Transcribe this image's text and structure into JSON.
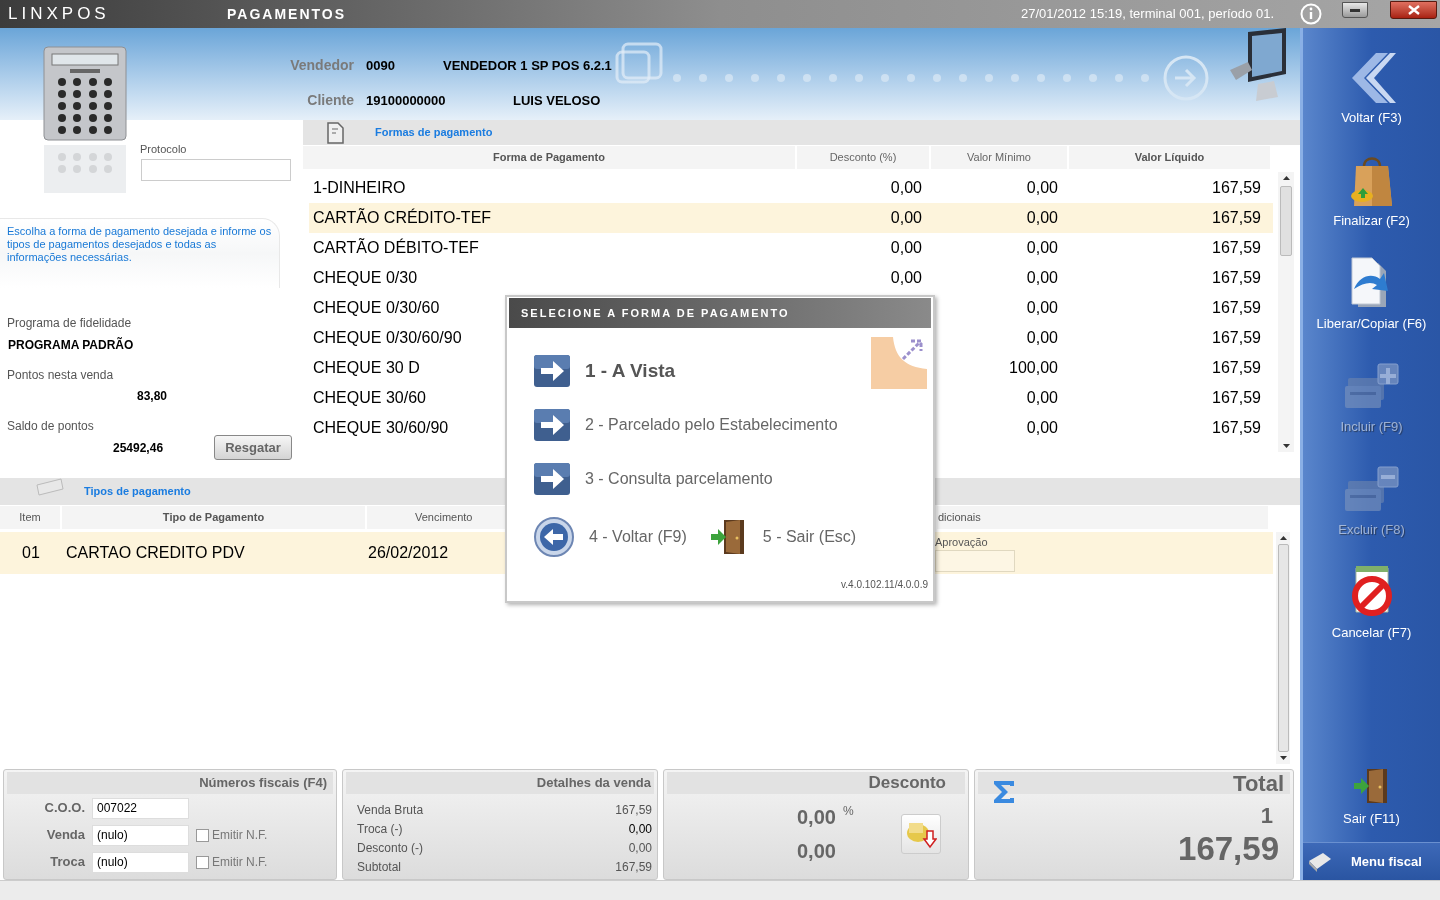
{
  "title_bar": {
    "app_name": "LINXPOS",
    "screen_title": "PAGAMENTOS",
    "session_info": "27/01/2012 15:19, terminal 001, período 01."
  },
  "header": {
    "vendedor": {
      "label": "Vendedor",
      "code": "0090",
      "name": "VENDEDOR 1 SP POS 6.2.1"
    },
    "cliente": {
      "label": "Cliente",
      "code": "19100000000",
      "name": "LUIS VELOSO"
    }
  },
  "protocolo": {
    "label": "Protocolo"
  },
  "help_text": "Escolha a forma de pagamento desejada e informe os tipos de pagamentos desejados e todas as informações necessárias.",
  "loyalty": {
    "program_label": "Programa de fidelidade",
    "program_name": "PROGRAMA PADRÃO",
    "points_label": "Pontos nesta venda",
    "points": "83,80",
    "balance_label": "Saldo de pontos",
    "balance": "25492,46",
    "redeem_button": "Resgatar"
  },
  "payment_forms": {
    "title": "Formas de pagamento",
    "columns": [
      "Forma de Pagamento",
      "Desconto (%)",
      "Valor Mínimo",
      "Valor Líquido"
    ],
    "rows": [
      {
        "name": "1-DINHEIRO",
        "discount": "0,00",
        "minimum": "0,00",
        "net": "167,59",
        "selected": false
      },
      {
        "name": "CARTÃO CRÉDITO-TEF",
        "discount": "0,00",
        "minimum": "0,00",
        "net": "167,59",
        "selected": true
      },
      {
        "name": "CARTÃO DÉBITO-TEF",
        "discount": "0,00",
        "minimum": "0,00",
        "net": "167,59",
        "selected": false
      },
      {
        "name": "CHEQUE 0/30",
        "discount": "0,00",
        "minimum": "0,00",
        "net": "167,59",
        "selected": false
      },
      {
        "name": "CHEQUE 0/30/60",
        "minimum": "0,00",
        "net": "167,59",
        "selected": false
      },
      {
        "name": "CHEQUE 0/30/60/90",
        "minimum": "0,00",
        "net": "167,59",
        "selected": false
      },
      {
        "name": "CHEQUE 30 D",
        "minimum": "100,00",
        "net": "167,59",
        "selected": false
      },
      {
        "name": "CHEQUE 30/60",
        "minimum": "0,00",
        "net": "167,59",
        "selected": false
      },
      {
        "name": "CHEQUE 30/60/90",
        "minimum": "0,00",
        "net": "167,59",
        "selected": false
      }
    ]
  },
  "payment_types": {
    "title": "Tipos de pagamento",
    "columns": [
      "Item",
      "Tipo de Pagamento",
      "Vencimento",
      "dicionais"
    ],
    "rows": [
      {
        "item": "01",
        "type": "CARTAO CREDITO PDV",
        "due": "26/02/2012",
        "approval_label": "Aprovação",
        "selected": true
      }
    ]
  },
  "dialog": {
    "title": "SELECIONE A FORMA DE PAGAMENTO",
    "options": [
      {
        "label": "1 - A Vista",
        "kind": "forward",
        "selected": true
      },
      {
        "label": "2 - Parcelado pelo Estabelecimento",
        "kind": "forward",
        "selected": false
      },
      {
        "label": "3 - Consulta parcelamento",
        "kind": "forward",
        "selected": false
      },
      {
        "label": "4 - Voltar (F9)",
        "kind": "back",
        "selected": false
      },
      {
        "label": "5 - Sair (Esc)",
        "kind": "exit",
        "selected": false
      }
    ],
    "version": "v.4.0.102.11/4.0.0.9"
  },
  "fiscal": {
    "title": "Números fiscais (F4)",
    "fields": [
      {
        "label": "C.O.O.",
        "value": "007022"
      },
      {
        "label": "Venda",
        "value": "(nulo)",
        "checkbox_label": "Emitir N.F.",
        "checked": false
      },
      {
        "label": "Troca",
        "value": "(nulo)",
        "checkbox_label": "Emitir N.F.",
        "checked": false
      }
    ]
  },
  "sale_details": {
    "title": "Detalhes da venda",
    "rows": [
      {
        "label": "Venda Bruta",
        "value": "167,59"
      },
      {
        "label": "Troca (-)",
        "value": "0,00"
      },
      {
        "label": "Desconto (-)",
        "value": "0,00"
      },
      {
        "label": "Subtotal",
        "value": "167,59"
      }
    ]
  },
  "discount": {
    "title": "Desconto",
    "percent": "0,00",
    "percent_sign": "%",
    "value": "0,00"
  },
  "total": {
    "title": "Total",
    "count": "1",
    "value": "167,59"
  },
  "sidebar": {
    "buttons": [
      {
        "label": "Voltar (F3)",
        "kind": "back",
        "disabled": false
      },
      {
        "label": "Finalizar (F2)",
        "kind": "bag",
        "disabled": false
      },
      {
        "label": "Liberar/Copiar (F6)",
        "kind": "copy",
        "disabled": false
      },
      {
        "label": "Incluir (F9)",
        "kind": "add",
        "disabled": true
      },
      {
        "label": "Excluir (F8)",
        "kind": "remove",
        "disabled": true
      },
      {
        "label": "Cancelar (F7)",
        "kind": "cancel",
        "disabled": false
      },
      {
        "label": "Sair (F11)",
        "kind": "exit",
        "disabled": false
      }
    ],
    "menu_label": "Menu fiscal"
  }
}
